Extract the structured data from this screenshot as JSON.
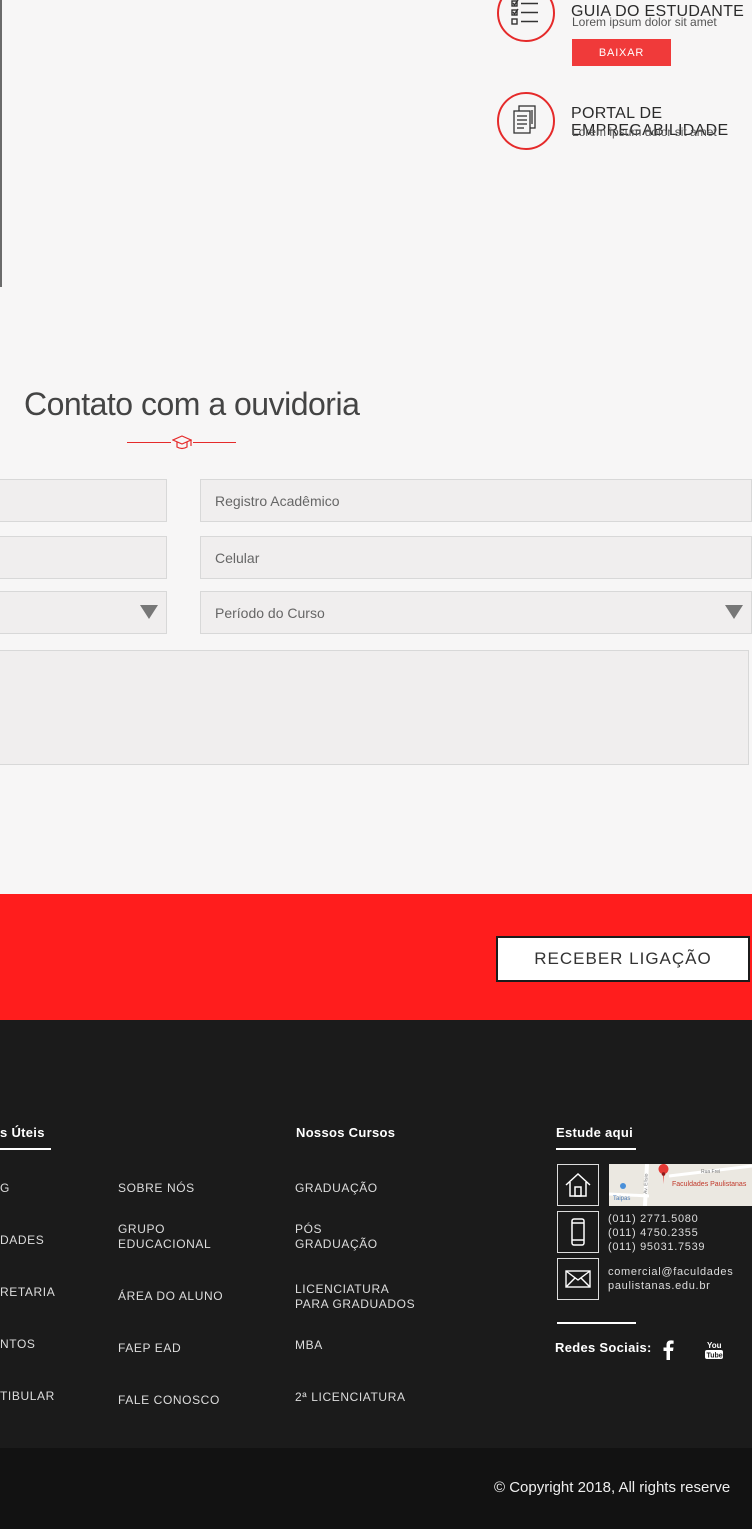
{
  "features": {
    "guia": {
      "title": "GUIA DO ESTUDANTE",
      "subtitle": "Lorem ipsum dolor sit amet",
      "button_label": "BAIXAR",
      "icon": "checklist-icon"
    },
    "portal": {
      "title_line1": "PORTAL DE",
      "title_line2": "EMPREGABILIDADE",
      "subtitle": "Lorem ipsum dolor sit amet",
      "icon": "document-files-icon"
    }
  },
  "contact": {
    "title": "Contato com a ouvidoria",
    "divider_icon": "graduation-cap-icon",
    "fields": {
      "registro_placeholder": "Registro Acadêmico",
      "celular_placeholder": "Celular",
      "periodo_placeholder": "Período do Curso"
    }
  },
  "cta": {
    "button_label": "RECEBER LIGAÇÃO"
  },
  "footer": {
    "links_heading": "s Úteis",
    "links_col1": [
      "G",
      "DADES",
      "RETARIA",
      "NTOS",
      "TIBULAR"
    ],
    "links_col2": [
      "SOBRE NÓS",
      "GRUPO\nEDUCACIONAL",
      "ÁREA DO ALUNO",
      "FAEP EAD",
      "FALE CONOSCO"
    ],
    "courses_heading": "Nossos Cursos",
    "courses": [
      "GRADUAÇÃO",
      "PÓS\nGRADUAÇÃO",
      "LICENCIATURA\nPARA GRADUADOS",
      "MBA",
      "2ª LICENCIATURA"
    ],
    "study_heading": "Estude aqui",
    "map_label": "Faculdades Paulistanas",
    "map_street": "Av. Elísio",
    "map_area": "Taipas",
    "map_road": "Rua Frei",
    "phones": [
      "(011) 2771.5080",
      "(011) 4750.2355",
      "(011) 95031.7539"
    ],
    "email_line1": "comercial@faculdades",
    "email_line2": "paulistanas.edu.br",
    "social_label": "Redes Sociais:",
    "social_icons": [
      "facebook-icon",
      "youtube-icon"
    ],
    "youtube_text_top": "You",
    "youtube_text_bottom": "Tube",
    "copyright": "© Copyright 2018, All rights reserve"
  },
  "colors": {
    "accent_red": "#ff1d1d",
    "button_red": "#f03a3a",
    "footer_bg": "#1b1b1b",
    "page_bg": "#f7f6f6"
  }
}
